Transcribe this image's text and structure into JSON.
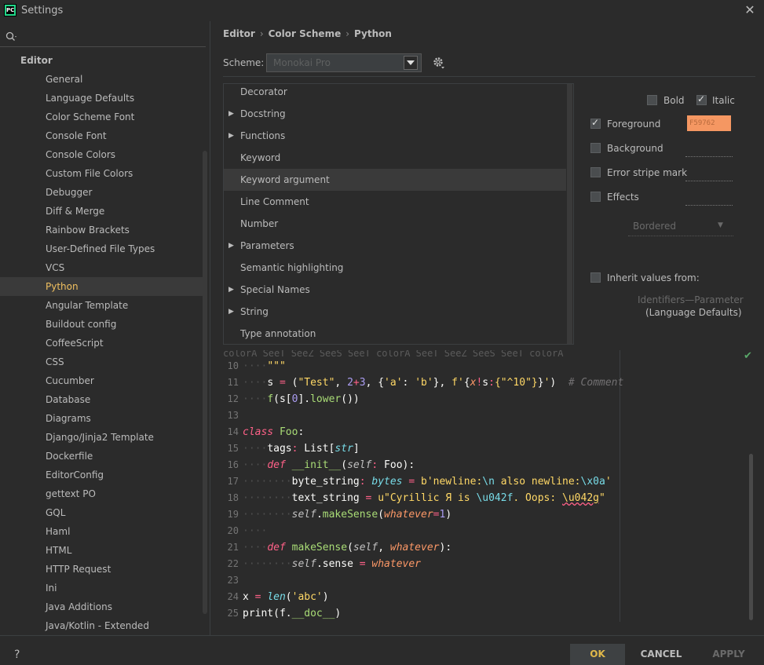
{
  "window": {
    "title": "Settings",
    "app_icon_text": "PC"
  },
  "sidebar": {
    "search_placeholder": "",
    "section": "Editor",
    "items": [
      "General",
      "Language Defaults",
      "Color Scheme Font",
      "Console Font",
      "Console Colors",
      "Custom File Colors",
      "Debugger",
      "Diff & Merge",
      "Rainbow Brackets",
      "User-Defined File Types",
      "VCS",
      "Python",
      "Angular Template",
      "Buildout config",
      "CoffeeScript",
      "CSS",
      "Cucumber",
      "Database",
      "Diagrams",
      "Django/Jinja2 Template",
      "Dockerfile",
      "EditorConfig",
      "gettext PO",
      "GQL",
      "Haml",
      "HTML",
      "HTTP Request",
      "Ini",
      "Java Additions",
      "Java/Kotlin - Extended"
    ],
    "selected": "Python"
  },
  "breadcrumb": [
    "Editor",
    "Color Scheme",
    "Python"
  ],
  "scheme": {
    "label": "Scheme:",
    "value": "Monokai Pro"
  },
  "elements": [
    {
      "label": "Decorator",
      "expandable": false
    },
    {
      "label": "Docstring",
      "expandable": true
    },
    {
      "label": "Functions",
      "expandable": true
    },
    {
      "label": "Keyword",
      "expandable": false
    },
    {
      "label": "Keyword argument",
      "expandable": false,
      "selected": true
    },
    {
      "label": "Line Comment",
      "expandable": false
    },
    {
      "label": "Number",
      "expandable": false
    },
    {
      "label": "Parameters",
      "expandable": true
    },
    {
      "label": "Semantic highlighting",
      "expandable": false
    },
    {
      "label": "Special Names",
      "expandable": true
    },
    {
      "label": "String",
      "expandable": true
    },
    {
      "label": "Type annotation",
      "expandable": false
    }
  ],
  "attributes": {
    "bold": {
      "label": "Bold",
      "checked": false
    },
    "italic": {
      "label": "Italic",
      "checked": true
    },
    "foreground": {
      "label": "Foreground",
      "checked": true,
      "value": "F59762",
      "color": "#f59762"
    },
    "background": {
      "label": "Background",
      "checked": false
    },
    "error_stripe": {
      "label": "Error stripe mark",
      "checked": false
    },
    "effects": {
      "label": "Effects",
      "checked": false,
      "type": "Bordered"
    },
    "inherit": {
      "label": "Inherit values from:",
      "checked": false,
      "link": "Identifiers—Parameter",
      "sub": "(Language Defaults)"
    }
  },
  "preview": {
    "top_partial": "colorA SeeT SeeZ SeeS SeeT colorA SeeT SeeZ SeeS SeeT colorA",
    "line_numbers": [
      "10",
      "11",
      "12",
      "13",
      "14",
      "15",
      "16",
      "17",
      "18",
      "19",
      "20",
      "21",
      "22",
      "23",
      "24",
      "25"
    ]
  },
  "footer": {
    "help": "?",
    "ok": "OK",
    "cancel": "CANCEL",
    "apply": "APPLY"
  }
}
